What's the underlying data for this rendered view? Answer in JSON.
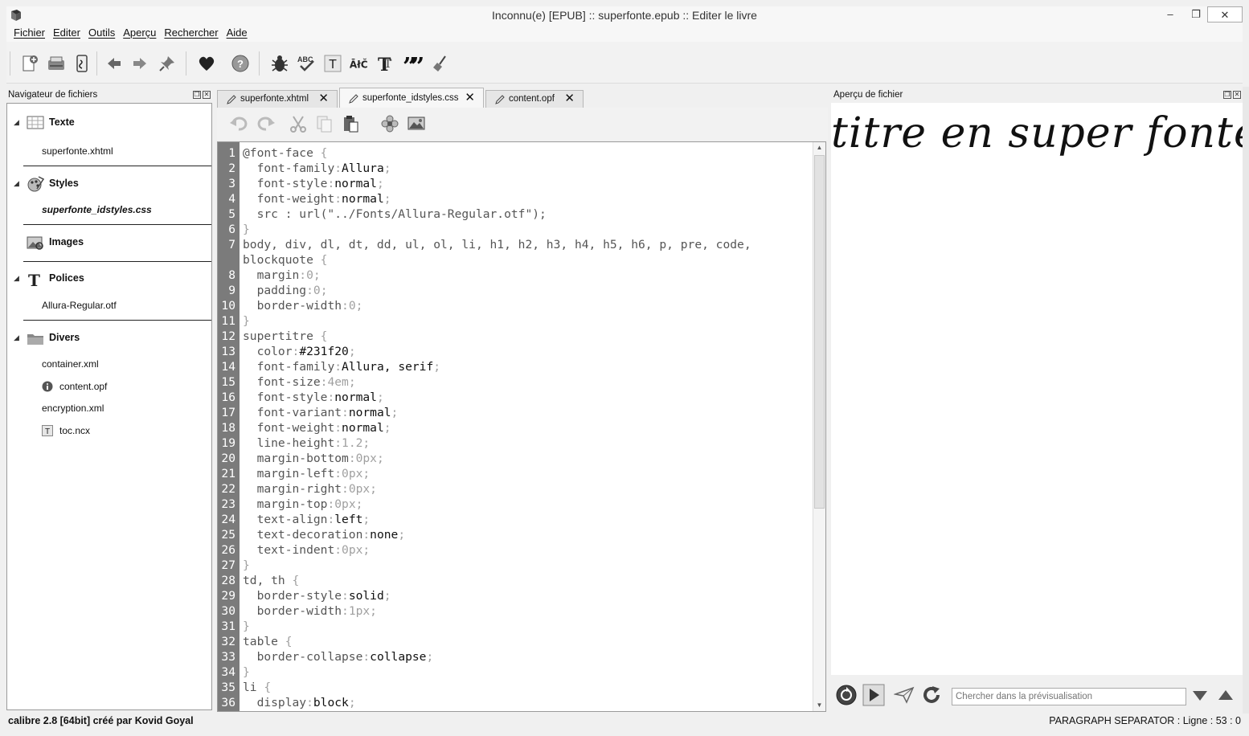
{
  "window": {
    "title": "Inconnu(e) [EPUB] :: superfonte.epub :: Editer le livre"
  },
  "menu": [
    "Fichier",
    "Editer",
    "Outils",
    "Aperçu",
    "Rechercher",
    "Aide"
  ],
  "file_browser": {
    "title": "Navigateur de fichiers",
    "groups": {
      "texte": {
        "label": "Texte",
        "files": [
          "superfonte.xhtml"
        ]
      },
      "styles": {
        "label": "Styles",
        "files": [
          "superfonte_idstyles.css"
        ]
      },
      "images": {
        "label": "Images",
        "files": []
      },
      "polices": {
        "label": "Polices",
        "files": [
          "Allura-Regular.otf"
        ]
      },
      "divers": {
        "label": "Divers",
        "files": [
          "container.xml",
          "content.opf",
          "encryption.xml",
          "toc.ncx"
        ]
      }
    }
  },
  "tabs": [
    "superfonte.xhtml",
    "superfonte_idstyles.css",
    "content.opf"
  ],
  "editor": {
    "lines": [
      {
        "n": "1",
        "sel": "@font-face",
        "brace": " {"
      },
      {
        "n": "2",
        "prop": "font-family",
        "val": "Allura"
      },
      {
        "n": "3",
        "prop": "font-style",
        "val": "normal"
      },
      {
        "n": "4",
        "prop": "font-weight",
        "val": "normal"
      },
      {
        "n": "5",
        "raw": "  src : url(\"../Fonts/Allura-Regular.otf\");"
      },
      {
        "n": "6",
        "close": "}"
      },
      {
        "n": "7",
        "sel": "body, div, dl, dt, dd, ul, ol, li, h1, h2, h3, h4, h5, h6, p, pre, code,",
        "brace": ""
      },
      {
        "n": "",
        "sel": "blockquote",
        "brace": " {"
      },
      {
        "n": "8",
        "prop": "margin",
        "val": "0"
      },
      {
        "n": "9",
        "prop": "padding",
        "val": "0"
      },
      {
        "n": "10",
        "prop": "border-width",
        "val": "0"
      },
      {
        "n": "11",
        "close": "}"
      },
      {
        "n": "12",
        "sel": "supertitre",
        "brace": " {"
      },
      {
        "n": "13",
        "prop": "color",
        "val": "#231f20"
      },
      {
        "n": "14",
        "prop": "font-family",
        "val": "Allura, serif"
      },
      {
        "n": "15",
        "prop": "font-size",
        "val": "4em"
      },
      {
        "n": "16",
        "prop": "font-style",
        "val": "normal"
      },
      {
        "n": "17",
        "prop": "font-variant",
        "val": "normal"
      },
      {
        "n": "18",
        "prop": "font-weight",
        "val": "normal"
      },
      {
        "n": "19",
        "prop": "line-height",
        "val": "1.2"
      },
      {
        "n": "20",
        "prop": "margin-bottom",
        "val": "0px"
      },
      {
        "n": "21",
        "prop": "margin-left",
        "val": "0px"
      },
      {
        "n": "22",
        "prop": "margin-right",
        "val": "0px"
      },
      {
        "n": "23",
        "prop": "margin-top",
        "val": "0px"
      },
      {
        "n": "24",
        "prop": "text-align",
        "val": "left"
      },
      {
        "n": "25",
        "prop": "text-decoration",
        "val": "none"
      },
      {
        "n": "26",
        "prop": "text-indent",
        "val": "0px"
      },
      {
        "n": "27",
        "close": "}"
      },
      {
        "n": "28",
        "sel": "td, th",
        "brace": " {"
      },
      {
        "n": "29",
        "prop": "border-style",
        "val": "solid"
      },
      {
        "n": "30",
        "prop": "border-width",
        "val": "1px"
      },
      {
        "n": "31",
        "close": "}"
      },
      {
        "n": "32",
        "sel": "table",
        "brace": " {"
      },
      {
        "n": "33",
        "prop": "border-collapse",
        "val": "collapse"
      },
      {
        "n": "34",
        "close": "}"
      },
      {
        "n": "35",
        "sel": "li",
        "brace": " {"
      },
      {
        "n": "36",
        "prop": "display",
        "val": "block"
      }
    ]
  },
  "preview": {
    "title": "Aperçu de fichier",
    "content": "titre en super fonte",
    "search_placeholder": "Chercher dans la prévisualisation"
  },
  "status": {
    "left": "calibre 2.8 [64bit] créé par Kovid Goyal",
    "right": "PARAGRAPH SEPARATOR : Ligne : 53 : 0"
  },
  "icons": {
    "toolbar": [
      "new-file-icon",
      "save-icon",
      "checkpoint-icon",
      "back-icon",
      "forward-icon",
      "pin-icon",
      "donate-heart-icon",
      "help-icon",
      "check-book-bug-icon",
      "spellcheck-icon",
      "text-icon",
      "transliterate-icon",
      "fonts-icon",
      "quotes-icon",
      "tidy-broom-icon"
    ],
    "editor": [
      "undo-icon",
      "redo-icon",
      "cut-icon",
      "copy-icon",
      "paste-icon",
      "beautify-flower-icon",
      "insert-image-icon"
    ]
  }
}
